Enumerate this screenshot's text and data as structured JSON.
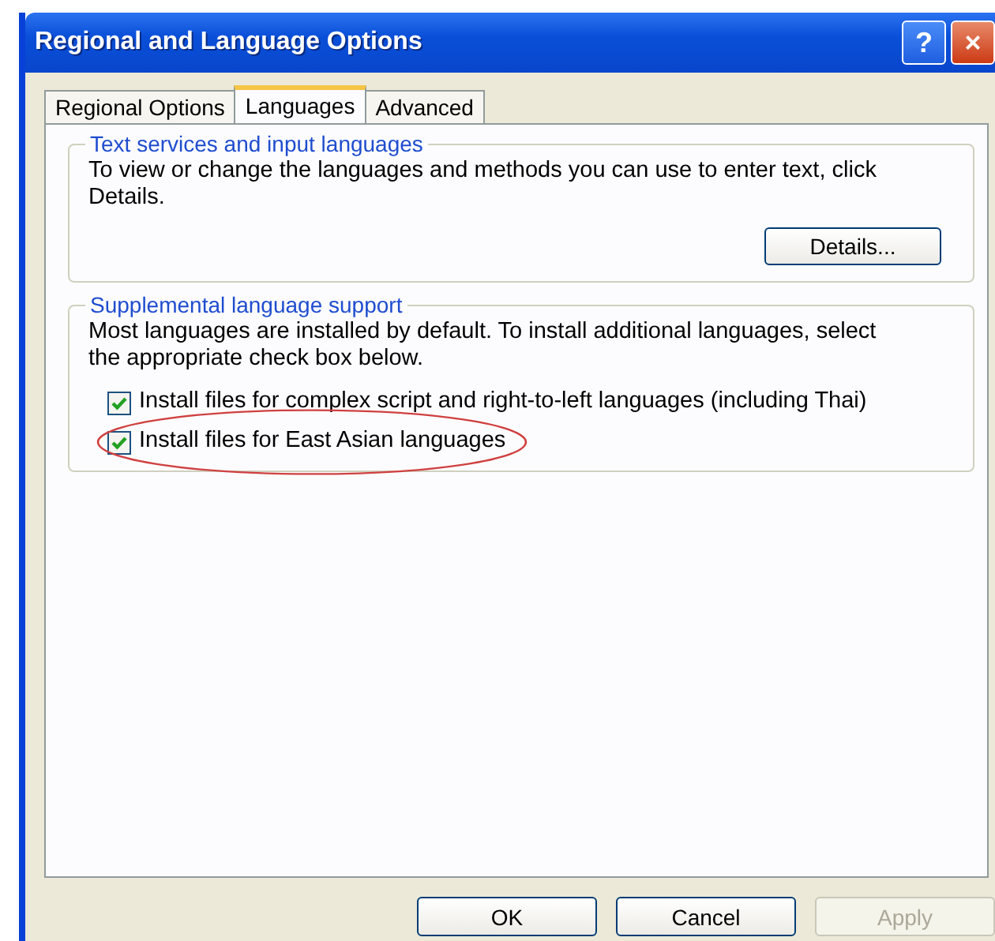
{
  "window": {
    "title": "Regional and Language Options"
  },
  "title_buttons": [
    {
      "kind": "help",
      "label": "?"
    },
    {
      "kind": "close",
      "label": "×"
    }
  ],
  "tabs": [
    {
      "label": "Regional Options",
      "selected": false
    },
    {
      "label": "Languages",
      "selected": true
    },
    {
      "label": "Advanced",
      "selected": false
    }
  ],
  "groups": [
    {
      "title": "Text services and input languages",
      "text": "To view or change the languages and methods you can use to enter text, click Details.",
      "button": "Details..."
    },
    {
      "title": "Supplemental language support",
      "text": "Most languages are installed by default. To install additional languages, select the appropriate check box below.",
      "options": [
        {
          "label": "Install files for complex script and right-to-left languages (including Thai)",
          "checked": true,
          "circled": false
        },
        {
          "label": "Install files for East Asian languages",
          "checked": true,
          "circled": true
        }
      ]
    }
  ],
  "buttons": [
    {
      "label": "OK",
      "disabled": false
    },
    {
      "label": "Cancel",
      "disabled": false
    },
    {
      "label": "Apply",
      "disabled": true
    }
  ]
}
